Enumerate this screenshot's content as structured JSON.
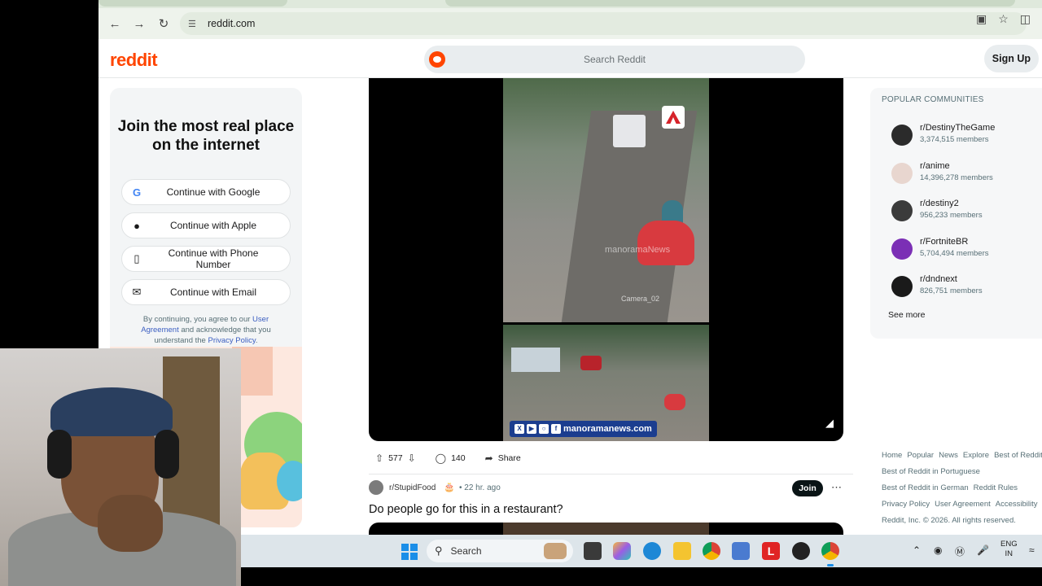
{
  "browser": {
    "url": "reddit.com"
  },
  "header": {
    "logo": "reddit",
    "search_placeholder": "Search Reddit",
    "signup_label": "Sign Up"
  },
  "join_card": {
    "title": "Join the most real place on the internet",
    "buttons": [
      {
        "label": "Continue with Google",
        "icon": "google-icon"
      },
      {
        "label": "Continue with Apple",
        "icon": "apple-icon"
      },
      {
        "label": "Continue with Phone Number",
        "icon": "phone-icon"
      },
      {
        "label": "Continue with Email",
        "icon": "email-icon"
      }
    ],
    "fine_print_1": "By continuing, you agree to our ",
    "user_agreement": "User Agreement",
    "fine_print_2": " and acknowledge that you understand the ",
    "privacy_policy": "Privacy Policy",
    "fine_print_3": "."
  },
  "post1": {
    "watermark": "manoramaNews",
    "camera_label": "Camera_02",
    "brand_bar": "manoramanews.com",
    "upvotes": "577",
    "comments": "140",
    "share_label": "Share"
  },
  "post2": {
    "subreddit": "r/StupidFood",
    "age": "22 hr. ago",
    "join_label": "Join",
    "title": "Do people go for this in a restaurant?"
  },
  "sidebar": {
    "header": "POPULAR COMMUNITIES",
    "communities": [
      {
        "name": "r/DestinyTheGame",
        "members": "3,374,515 members",
        "color": "#2b2b2b"
      },
      {
        "name": "r/anime",
        "members": "14,396,278 members",
        "color": "#e8d6cf"
      },
      {
        "name": "r/destiny2",
        "members": "956,233 members",
        "color": "#3b3b3b"
      },
      {
        "name": "r/FortniteBR",
        "members": "5,704,494 members",
        "color": "#7b2fb5"
      },
      {
        "name": "r/dndnext",
        "members": "826,751 members",
        "color": "#1a1a1a"
      }
    ],
    "see_more": "See more"
  },
  "footer": {
    "line1": [
      "Home",
      "Popular",
      "News",
      "Explore",
      "Best of Reddit"
    ],
    "line2": "Best of Reddit in Portuguese",
    "line3": [
      "Best of Reddit in German",
      "Reddit Rules"
    ],
    "line4": [
      "Privacy Policy",
      "User Agreement",
      "Accessibility"
    ],
    "copyright": "Reddit, Inc. © 2026. All rights reserved."
  },
  "taskbar": {
    "search_label": "Search",
    "lang_1": "ENG",
    "lang_2": "IN"
  },
  "colors": {
    "reddit_orange": "#ff4500",
    "join_button": "#0a1416",
    "link_blue": "#3b5ec1"
  }
}
